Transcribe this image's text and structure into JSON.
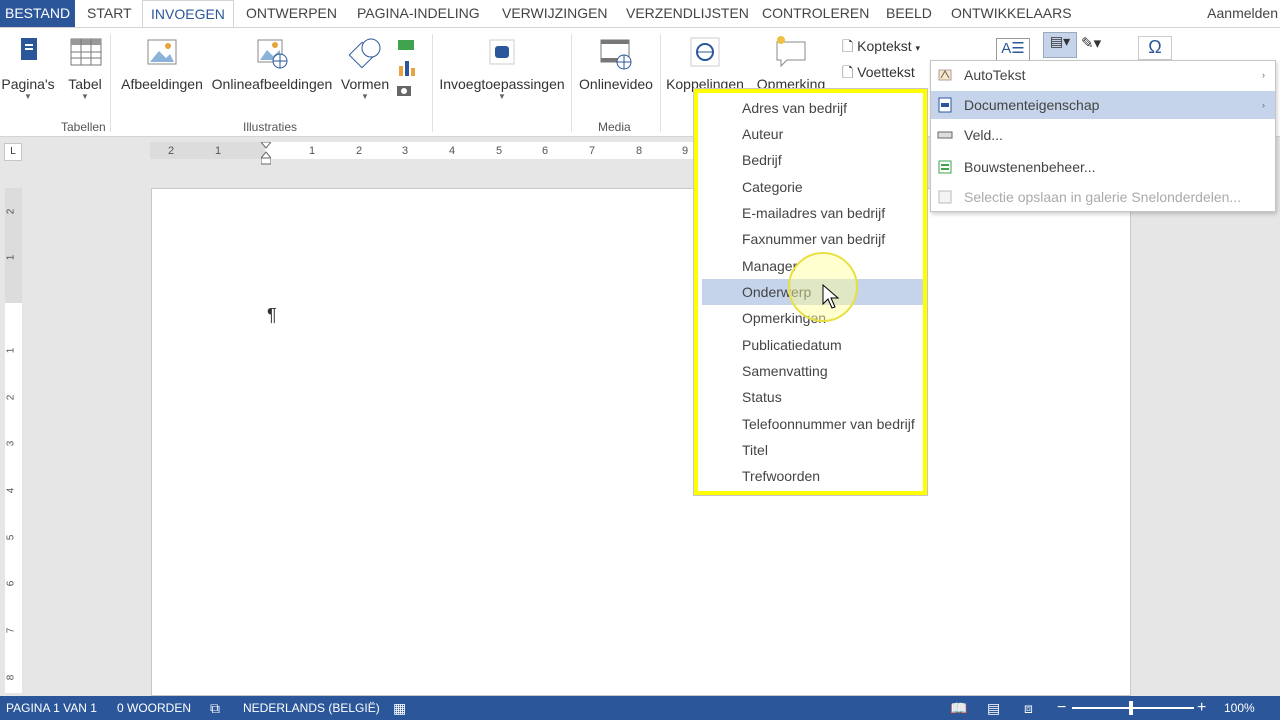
{
  "tabs": {
    "file": "BESTAND",
    "items": [
      "START",
      "INVOEGEN",
      "ONTWERPEN",
      "PAGINA-INDELING",
      "VERWIJZINGEN",
      "VERZENDLIJSTEN",
      "CONTROLEREN",
      "BEELD",
      "ONTWIKKELAARS"
    ],
    "active": "INVOEGEN",
    "signin": "Aanmelden"
  },
  "ribbon": {
    "pages": "Pagina's",
    "table": "Tabel",
    "pictures": "Afbeeldingen",
    "online_pictures": "Onlineafbeeldingen",
    "shapes": "Vormen",
    "apps": "Invoegtoepassingen",
    "online_video": "Onlinevideo",
    "links": "Koppelingen",
    "comment": "Opmerking",
    "header": "Koptekst",
    "footer": "Voettekst",
    "group_tables": "Tabellen",
    "group_illustrations": "Illustraties",
    "group_media": "Media"
  },
  "ruler": {
    "h_ticks": [
      "2",
      "1",
      "1",
      "2",
      "3",
      "4",
      "5",
      "6",
      "7",
      "8",
      "9"
    ],
    "v_ticks": [
      "2",
      "1",
      "1",
      "2",
      "3",
      "4",
      "5",
      "6",
      "7",
      "8"
    ]
  },
  "document": {
    "pilcrow": "¶"
  },
  "quickparts_menu": {
    "items": [
      {
        "label": "AutoTekst",
        "arrow": "›"
      },
      {
        "label": "Documenteigenschap",
        "arrow": "›"
      },
      {
        "label": "Veld...",
        "arrow": ""
      },
      {
        "label": "Bouwstenenbeheer...",
        "arrow": ""
      },
      {
        "label": "Selectie opslaan in galerie Snelonderdelen...",
        "arrow": ""
      }
    ]
  },
  "docprop_menu": {
    "items": [
      "Adres van bedrijf",
      "Auteur",
      "Bedrijf",
      "Categorie",
      "E-mailadres van bedrijf",
      "Faxnummer van bedrijf",
      "Manager",
      "Onderwerp",
      "Opmerkingen",
      "Publicatiedatum",
      "Samenvatting",
      "Status",
      "Telefoonnummer van bedrijf",
      "Titel",
      "Trefwoorden"
    ],
    "highlighted": "Onderwerp"
  },
  "statusbar": {
    "page": "PAGINA 1 VAN 1",
    "words": "0 WOORDEN",
    "language": "NEDERLANDS (BELGIË)",
    "zoom": "100%"
  },
  "colors": {
    "accent": "#2b579a",
    "highlight": "#c5d4ea",
    "callout": "#ffff00"
  }
}
